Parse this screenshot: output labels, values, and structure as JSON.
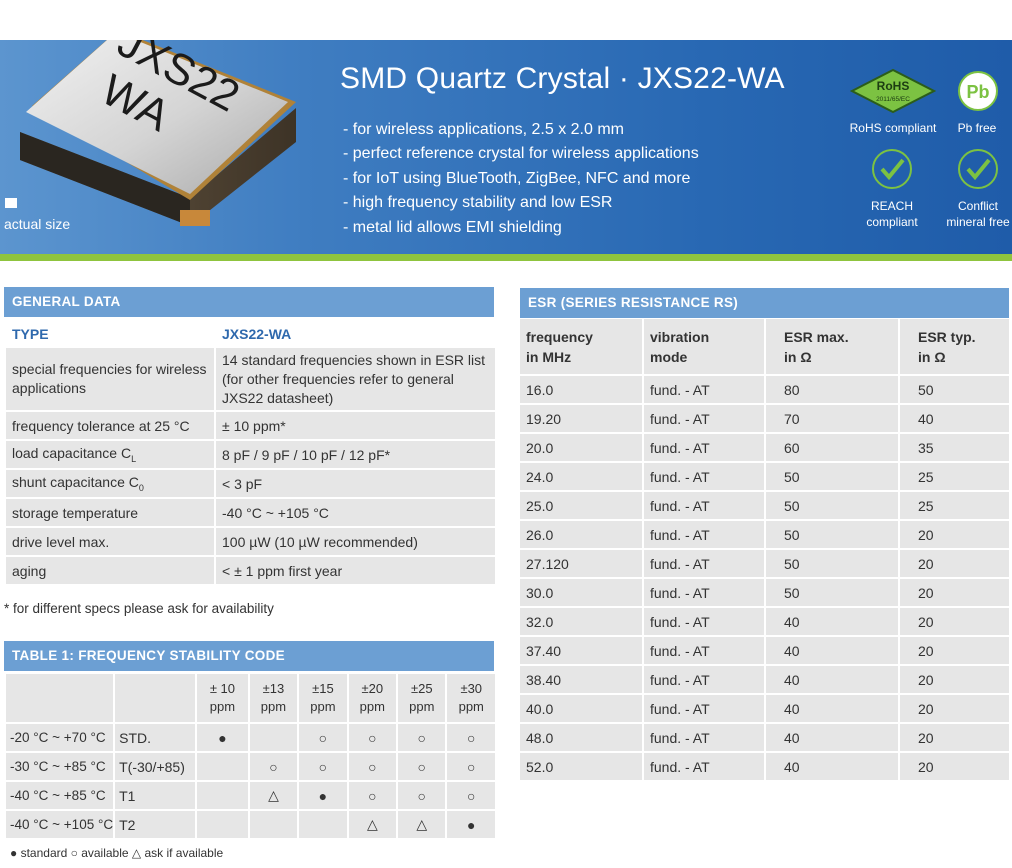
{
  "banner": {
    "title": "SMD Quartz Crystal · JXS22-WA",
    "crystal_marking_line1": "JXS22",
    "crystal_marking_line2": "WA",
    "actual_size_label": "actual size",
    "features": [
      "- for wireless applications, 2.5 x 2.0 mm",
      "- perfect reference crystal for wireless applications",
      "- for IoT using BlueTooth, ZigBee, NFC and more",
      "- high frequency stability and low ESR",
      "- metal lid allows EMI shielding"
    ],
    "badges": {
      "rohs_logo_text": "RoHS",
      "rohs_logo_sub": "2011/65/EC",
      "rohs_label": "RoHS compliant",
      "pb_logo_text": "Pb",
      "pb_label": "Pb free",
      "reach_label_1": "REACH",
      "reach_label_2": "compliant",
      "conflict_label_1": "Conflict",
      "conflict_label_2": "mineral free"
    },
    "colors": {
      "accent_blue": "#2868b3",
      "stripe_green": "#8fc43e",
      "badge_green": "#7cc242"
    }
  },
  "general": {
    "heading": "GENERAL DATA",
    "type_label": "TYPE",
    "type_value": "JXS22-WA",
    "rows": [
      {
        "key": "special frequencies for wireless applications",
        "value": "14 standard frequencies shown in ESR list (for other frequencies refer to general JXS22 datasheet)"
      },
      {
        "key": "frequency tolerance at 25 °C",
        "value": "± 10 ppm*"
      },
      {
        "key": "load capacitance C",
        "key_sub": "L",
        "value": "8 pF / 9 pF / 10 pF / 12 pF*"
      },
      {
        "key": "shunt capacitance C",
        "key_sub": "0",
        "value": "< 3 pF"
      },
      {
        "key": "storage temperature",
        "value": "-40 °C ~ +105 °C"
      },
      {
        "key": "drive level max.",
        "value": "100 µW (10 µW recommended)"
      },
      {
        "key": "aging",
        "value": "< ± 1 ppm first year"
      }
    ],
    "footnote": "* for different specs please ask for availability"
  },
  "stability": {
    "heading": "TABLE 1: FREQUENCY STABILITY CODE",
    "columns": [
      "± 10 ppm",
      "±13 ppm",
      "±15 ppm",
      "±20 ppm",
      "±25 ppm",
      "±30 ppm"
    ],
    "rows": [
      {
        "temp": "-20 °C ~ +70 °C",
        "code": "STD.",
        "cells": [
          "●",
          "",
          "○",
          "○",
          "○",
          "○"
        ]
      },
      {
        "temp": "-30 °C ~ +85 °C",
        "code": "T(-30/+85)",
        "cells": [
          "",
          "○",
          "○",
          "○",
          "○",
          "○"
        ]
      },
      {
        "temp": "-40 °C ~ +85 °C",
        "code": "T1",
        "cells": [
          "",
          "△",
          "●",
          "○",
          "○",
          "○"
        ]
      },
      {
        "temp": "-40 °C ~ +105 °C",
        "code": "T2",
        "cells": [
          "",
          "",
          "",
          "△",
          "△",
          "●"
        ]
      }
    ],
    "legend": "● standard ○ available △ ask if available"
  },
  "esr": {
    "heading": "ESR (SERIES RESISTANCE RS)",
    "headers": [
      {
        "l1": "frequency",
        "l2": "in MHz"
      },
      {
        "l1": "vibration",
        "l2": "mode"
      },
      {
        "l1": "ESR max.",
        "l2": "in Ω"
      },
      {
        "l1": "ESR typ.",
        "l2": "in Ω"
      }
    ],
    "rows": [
      [
        "16.0",
        "fund. - AT",
        "80",
        "50"
      ],
      [
        "19.20",
        "fund. - AT",
        "70",
        "40"
      ],
      [
        "20.0",
        "fund. - AT",
        "60",
        "35"
      ],
      [
        "24.0",
        "fund. - AT",
        "50",
        "25"
      ],
      [
        "25.0",
        "fund. - AT",
        "50",
        "25"
      ],
      [
        "26.0",
        "fund. - AT",
        "50",
        "20"
      ],
      [
        "27.120",
        "fund. - AT",
        "50",
        "20"
      ],
      [
        "30.0",
        "fund. - AT",
        "50",
        "20"
      ],
      [
        "32.0",
        "fund. - AT",
        "40",
        "20"
      ],
      [
        "37.40",
        "fund. - AT",
        "40",
        "20"
      ],
      [
        "38.40",
        "fund. - AT",
        "40",
        "20"
      ],
      [
        "40.0",
        "fund. - AT",
        "40",
        "20"
      ],
      [
        "48.0",
        "fund. - AT",
        "40",
        "20"
      ],
      [
        "52.0",
        "fund. - AT",
        "40",
        "20"
      ]
    ]
  }
}
